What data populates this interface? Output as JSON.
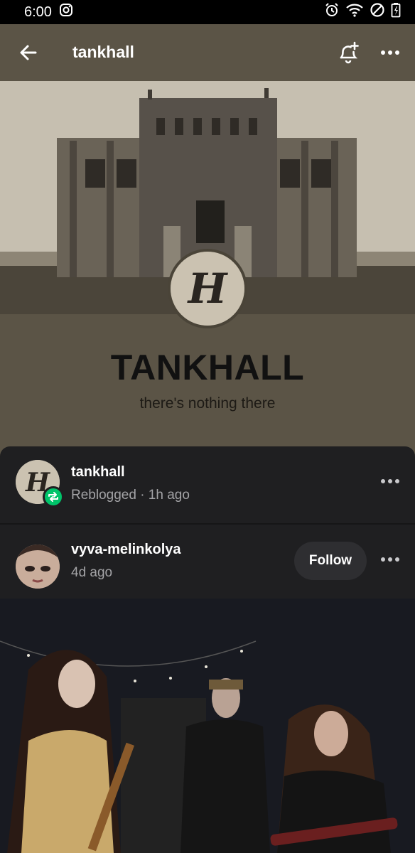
{
  "status_bar": {
    "time": "6:00",
    "icons": [
      "instagram-icon",
      "alarm-icon",
      "wifi-icon",
      "dnd-icon",
      "battery-icon"
    ]
  },
  "header": {
    "title": "tankhall",
    "icons": [
      "back-arrow-icon",
      "bell-plus-icon",
      "more-icon"
    ]
  },
  "profile": {
    "name": "TANKHALL",
    "description": "there's nothing there",
    "avatar_letter": "H"
  },
  "posts": [
    {
      "username": "tankhall",
      "meta": "Reblogged · 1h ago",
      "reblog": true
    },
    {
      "username": "vyva-melinkolya",
      "meta": "4d ago",
      "follow_label": "Follow"
    }
  ],
  "colors": {
    "header_bg": "#5b5446",
    "card_bg": "#1f1f21",
    "reblog_green": "#00c46a",
    "muted_text": "#a3a3a6"
  }
}
